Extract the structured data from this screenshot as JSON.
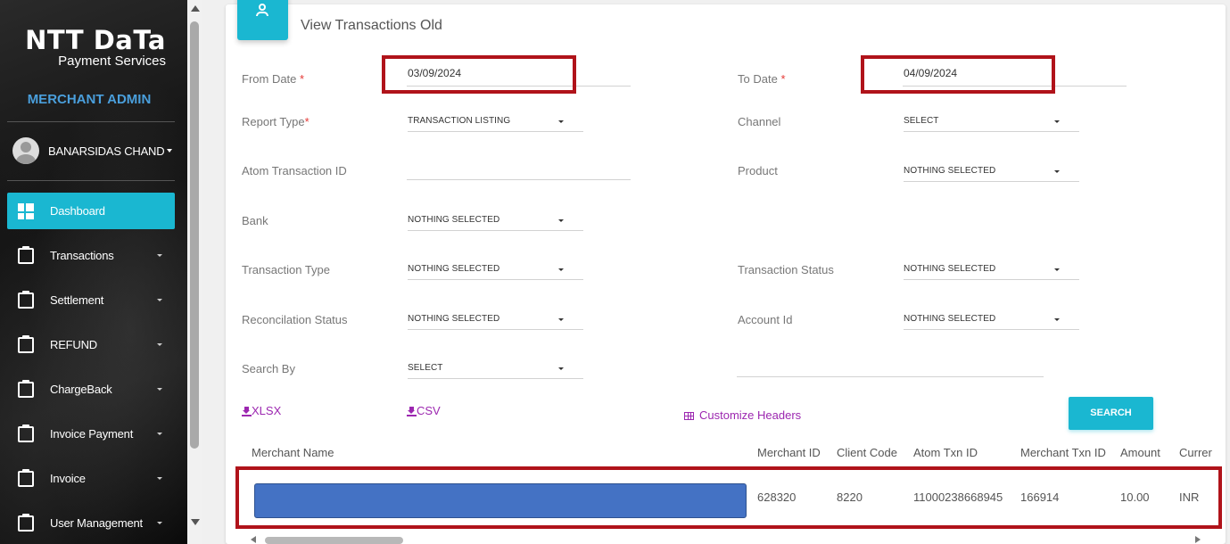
{
  "sidebar": {
    "logo_main": "NTT DaTa",
    "logo_sub": "Payment Services",
    "role": "MERCHANT ADMIN",
    "user_name": "BANARSIDAS CHAND",
    "items": [
      {
        "label": "Dashboard",
        "icon": "dashboard-icon",
        "active": true
      },
      {
        "label": "Transactions",
        "icon": "clipboard-icon"
      },
      {
        "label": "Settlement",
        "icon": "clipboard-icon"
      },
      {
        "label": "REFUND",
        "icon": "clipboard-icon"
      },
      {
        "label": "ChargeBack",
        "icon": "clipboard-icon"
      },
      {
        "label": "Invoice Payment",
        "icon": "clipboard-icon"
      },
      {
        "label": "Invoice",
        "icon": "clipboard-icon"
      },
      {
        "label": "User Management",
        "icon": "clipboard-icon"
      }
    ]
  },
  "page": {
    "title": "View Transactions Old",
    "header_icon": "person-icon"
  },
  "form": {
    "from_date_label": "From Date",
    "from_date_value": "03/09/2024",
    "to_date_label": "To Date",
    "to_date_value": "04/09/2024",
    "required_mark": "*",
    "report_type_label": "Report Type",
    "report_type_value": "TRANSACTION LISTING",
    "channel_label": "Channel",
    "channel_value": "SELECT",
    "atom_txn_id_label": "Atom Transaction ID",
    "atom_txn_id_value": "",
    "product_label": "Product",
    "product_value": "NOTHING SELECTED",
    "bank_label": "Bank",
    "bank_value": "NOTHING SELECTED",
    "txn_type_label": "Transaction Type",
    "txn_type_value": "NOTHING SELECTED",
    "txn_status_label": "Transaction Status",
    "txn_status_value": "NOTHING SELECTED",
    "recon_status_label": "Reconcilation Status",
    "recon_status_value": "NOTHING SELECTED",
    "account_id_label": "Account Id",
    "account_id_value": "NOTHING SELECTED",
    "search_by_label": "Search By",
    "search_by_value": "SELECT",
    "search_by_text": ""
  },
  "actions": {
    "xlsx": "XLSX",
    "csv": "CSV",
    "customize_headers": "Customize Headers",
    "search": "SEARCH"
  },
  "table": {
    "headers": [
      "Merchant Name",
      "Merchant ID",
      "Client Code",
      "Atom Txn ID",
      "Merchant Txn ID",
      "Amount",
      "Currer"
    ],
    "rows": [
      {
        "merchant_name": "",
        "merchant_id": "628320",
        "client_code": "8220",
        "atom_txn_id": "11000238668945",
        "merchant_txn_id": "166914",
        "amount": "10.00",
        "currency": "INR"
      }
    ]
  },
  "colors": {
    "accent": "#1ab7d1",
    "highlight_box": "#b0131a",
    "link": "#9c27b0",
    "mask": "#4472c4"
  }
}
